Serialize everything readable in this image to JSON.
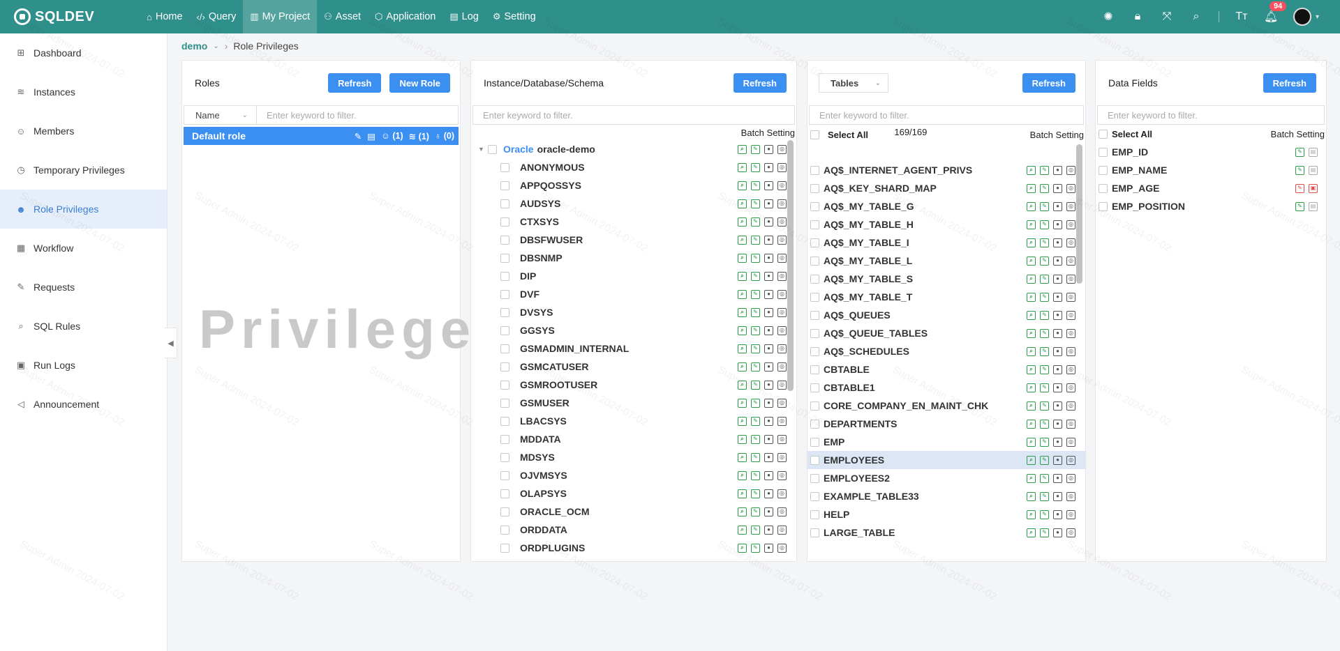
{
  "app": {
    "logo": "SQLDEV"
  },
  "nav": [
    {
      "label": "Home",
      "icon": "home-icon",
      "active": false
    },
    {
      "label": "Query",
      "icon": "code-icon",
      "active": false
    },
    {
      "label": "My Project",
      "icon": "project-icon",
      "active": true
    },
    {
      "label": "Asset",
      "icon": "asset-icon",
      "active": false
    },
    {
      "label": "Application",
      "icon": "cube-icon",
      "active": false
    },
    {
      "label": "Log",
      "icon": "log-icon",
      "active": false
    },
    {
      "label": "Setting",
      "icon": "gear-icon",
      "active": false
    }
  ],
  "top_right": {
    "notification_count": "94",
    "font_label": "Tт"
  },
  "sidebar": [
    {
      "label": "Dashboard",
      "icon": "dashboard-icon"
    },
    {
      "label": "Instances",
      "icon": "database-icon"
    },
    {
      "label": "Members",
      "icon": "members-icon"
    },
    {
      "label": "Temporary Privileges",
      "icon": "clock-icon"
    },
    {
      "label": "Role Privileges",
      "icon": "user-icon",
      "active": true
    },
    {
      "label": "Workflow",
      "icon": "workflow-icon"
    },
    {
      "label": "Requests",
      "icon": "requests-icon"
    },
    {
      "label": "SQL Rules",
      "icon": "rules-icon"
    },
    {
      "label": "Run Logs",
      "icon": "runlogs-icon"
    },
    {
      "label": "Announcement",
      "icon": "megaphone-icon"
    }
  ],
  "breadcrumb": {
    "project": "demo",
    "current": "Role Privileges"
  },
  "roles_panel": {
    "title": "Roles",
    "refresh": "Refresh",
    "new_role": "New Role",
    "filter_select": "Name",
    "filter_placeholder": "Enter keyword to filter.",
    "roles": [
      {
        "name": "Default role",
        "users": "(1)",
        "instances": "(1)",
        "rules": "(0)"
      }
    ],
    "watermark": "Privilege"
  },
  "schema_panel": {
    "title": "Instance/Database/Schema",
    "refresh": "Refresh",
    "filter_placeholder": "Enter keyword to filter.",
    "batch": "Batch Setting",
    "instance_type": "Oracle",
    "instance_name": "oracle-demo",
    "schemas": [
      "ANONYMOUS",
      "APPQOSSYS",
      "AUDSYS",
      "CTXSYS",
      "DBSFWUSER",
      "DBSNMP",
      "DIP",
      "DVF",
      "DVSYS",
      "GGSYS",
      "GSMADMIN_INTERNAL",
      "GSMCATUSER",
      "GSMROOTUSER",
      "GSMUSER",
      "LBACSYS",
      "MDDATA",
      "MDSYS",
      "OJVMSYS",
      "OLAPSYS",
      "ORACLE_OCM",
      "ORDDATA",
      "ORDPLUGINS"
    ]
  },
  "tables_panel": {
    "select": "Tables",
    "refresh": "Refresh",
    "filter_placeholder": "Enter keyword to filter.",
    "select_all": "Select All",
    "count": "169/169",
    "batch": "Batch Setting",
    "tables": [
      "AQ$_INTERNET_AGENT_PRIVS",
      "AQ$_KEY_SHARD_MAP",
      "AQ$_MY_TABLE_G",
      "AQ$_MY_TABLE_H",
      "AQ$_MY_TABLE_I",
      "AQ$_MY_TABLE_L",
      "AQ$_MY_TABLE_S",
      "AQ$_MY_TABLE_T",
      "AQ$_QUEUES",
      "AQ$_QUEUE_TABLES",
      "AQ$_SCHEDULES",
      "CBTABLE",
      "CBTABLE1",
      "CORE_COMPANY_EN_MAINT_CHK",
      "DEPARTMENTS",
      "EMP",
      "EMPLOYEES",
      "EMPLOYEES2",
      "EXAMPLE_TABLE33",
      "HELP",
      "LARGE_TABLE"
    ],
    "highlighted": "EMPLOYEES"
  },
  "fields_panel": {
    "title": "Data Fields",
    "refresh": "Refresh",
    "filter_placeholder": "Enter keyword to filter.",
    "select_all": "Select All",
    "batch": "Batch Setting",
    "fields": [
      {
        "name": "EMP_ID",
        "state": "green"
      },
      {
        "name": "EMP_NAME",
        "state": "green"
      },
      {
        "name": "EMP_AGE",
        "state": "red"
      },
      {
        "name": "EMP_POSITION",
        "state": "green"
      }
    ]
  },
  "watermark_text": "Super Admin 2024-07-02",
  "colors": {
    "topbar": "#2f8f8a",
    "primary": "#3b8ff1",
    "action_green": "#2a9d48",
    "action_red": "#e34a4a",
    "selected_row": "#dce6f4"
  }
}
